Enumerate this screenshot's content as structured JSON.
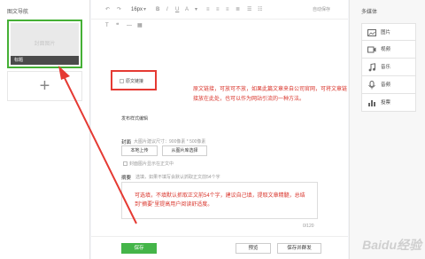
{
  "left_nav": {
    "title": "图文导航",
    "cover_placeholder": "封面图片",
    "cover_caption": "标题",
    "add_symbol": "+"
  },
  "toolbar": {
    "font_size": "16px",
    "autosave": "自动保存"
  },
  "link_option": {
    "label": "原文链接",
    "note": "原文链接，可放可不放，如果此篇文章来自公司官网，可将文章链接放在此处，也可以作为网站引流的一种方法。"
  },
  "publish": {
    "section_title": "发布样式编辑",
    "cover_label": "封面",
    "cover_hint": "大图片建议尺寸：900像素 * 500像素",
    "local_upload": "本地上传",
    "from_library": "从图片库选择",
    "show_cover_in_body": "封面图片显示在正文中",
    "summary_label": "摘要",
    "summary_hint": "选填，如果不填写会默认抓取正文前54个字",
    "summary_note": "可选填，不填默认抓取正文前54个字，建议自己填，提取文章精髓，总结到\"摘要\"里提高用户阅读舒适度。",
    "counter": "0/120"
  },
  "footer": {
    "save": "保存",
    "preview": "预览",
    "save_send": "保存并群发"
  },
  "media_panel": {
    "title": "多媒体",
    "items": [
      {
        "label": "图片",
        "icon": "image-icon"
      },
      {
        "label": "视频",
        "icon": "video-icon"
      },
      {
        "label": "音乐",
        "icon": "music-icon"
      },
      {
        "label": "音频",
        "icon": "audio-icon"
      },
      {
        "label": "投票",
        "icon": "vote-icon"
      }
    ]
  },
  "colors": {
    "accent_green": "#44b549",
    "annotation_red": "#d9342b"
  },
  "watermark": "Baidu经验"
}
